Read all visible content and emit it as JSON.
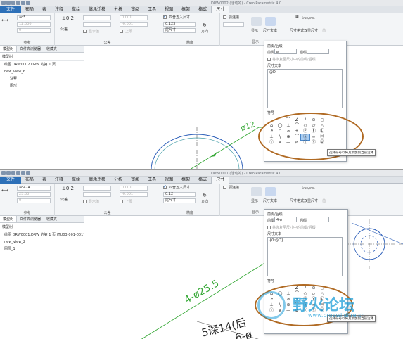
{
  "app": {
    "title1": "DRW0002 (活动的) - Creo Parametric 4.0",
    "title2": "DRW0001 (活动的) - Creo Parametric 4.0"
  },
  "tabs": [
    "文件",
    "布局",
    "表",
    "注释",
    "草绘",
    "继承迁移",
    "分析",
    "审阅",
    "工具",
    "视图",
    "框架",
    "格式",
    "尺寸"
  ],
  "ribbon": {
    "value_top_1": "ad5",
    "value_top_2": "ad474",
    "value_sub": "12.000",
    "value_sub_2": "25.00",
    "value_zero": "0",
    "nominal": "公差",
    "display_label": "显示值",
    "tol_upper": "0.001",
    "tol_lower": "-0.001",
    "tol_upper_label": "上限",
    "round_label": "四舍五入尺寸",
    "precision_value_1": "0.123",
    "precision_value_2": "0.12",
    "dim_type": "尾尺寸",
    "direction": "方向",
    "display_btn": "显示",
    "dim_text_btn": "尺寸文本",
    "dim_format_btn": "尺寸格式",
    "dual_btn": "双重尺寸",
    "fill_btn": "值",
    "unit_label": "inch\nmm",
    "dim_name_label": "弧连接",
    "groups": {
      "ref": "参考",
      "tol": "公差",
      "precision": "精度",
      "display": "显示"
    }
  },
  "tree": {
    "tabs": [
      "模型树",
      "文件夹浏览器",
      "收藏夹"
    ],
    "header": "模型树",
    "root_1": "绘图 DRW0002.DRW 的第 1 页",
    "root_2": "绘图 DRW0001.DRW 的第 1 页 (TU03-001-001)",
    "view_1": "new_view_6",
    "view_2": "new_view_2",
    "child_1a": "注释",
    "child_1b": "图形",
    "child_2a": "图层_1"
  },
  "dialog": {
    "prefix_suffix_label": "前缀/后缀",
    "prefix_label": "前缀",
    "suffix_label": "后缀",
    "prefix_1": "ø",
    "prefix_2": "4-ø",
    "reset_label": "将恢复至尺寸中的前缀/后缀",
    "dim_text_label": "尺寸文本",
    "dim_text_1": "@D",
    "dim_text_2": "{0:@D}",
    "symbol_label": "符号",
    "symbols": [
      "—",
      "—",
      "⌒",
      "∠",
      "/",
      "⊕",
      "○",
      "⌂",
      "◯",
      "⊥",
      "⌒",
      "◇",
      "▱",
      "△",
      "↗",
      "⊂",
      "⌀",
      "±",
      "Ⓟ",
      "Ⓕ",
      "Ⓛ",
      "⊥",
      "//",
      "⊕",
      "⌒",
      "Ⓢ",
      "∞",
      "Ⓜ",
      "Ⓣ",
      "∨",
      "—",
      "ø",
      "ⓔ",
      "Ⓢ",
      "Ⓤ"
    ],
    "tooltip": "选择符号以将其添加到当前注释"
  },
  "canvas": {
    "dim1": "ø12",
    "dim2": "4-ø25.5",
    "dim3": "5深14(后",
    "dim4": "6-ø"
  },
  "watermark": {
    "text": "野火论坛",
    "url": "www.proewildfire.cn"
  },
  "colors": {
    "file_tab": "#2d70b8",
    "highlight": "#b06a23",
    "dim_green": "#35a835",
    "geom_blue": "#2a5db8",
    "watermark_blue": "#1b9dd8"
  }
}
